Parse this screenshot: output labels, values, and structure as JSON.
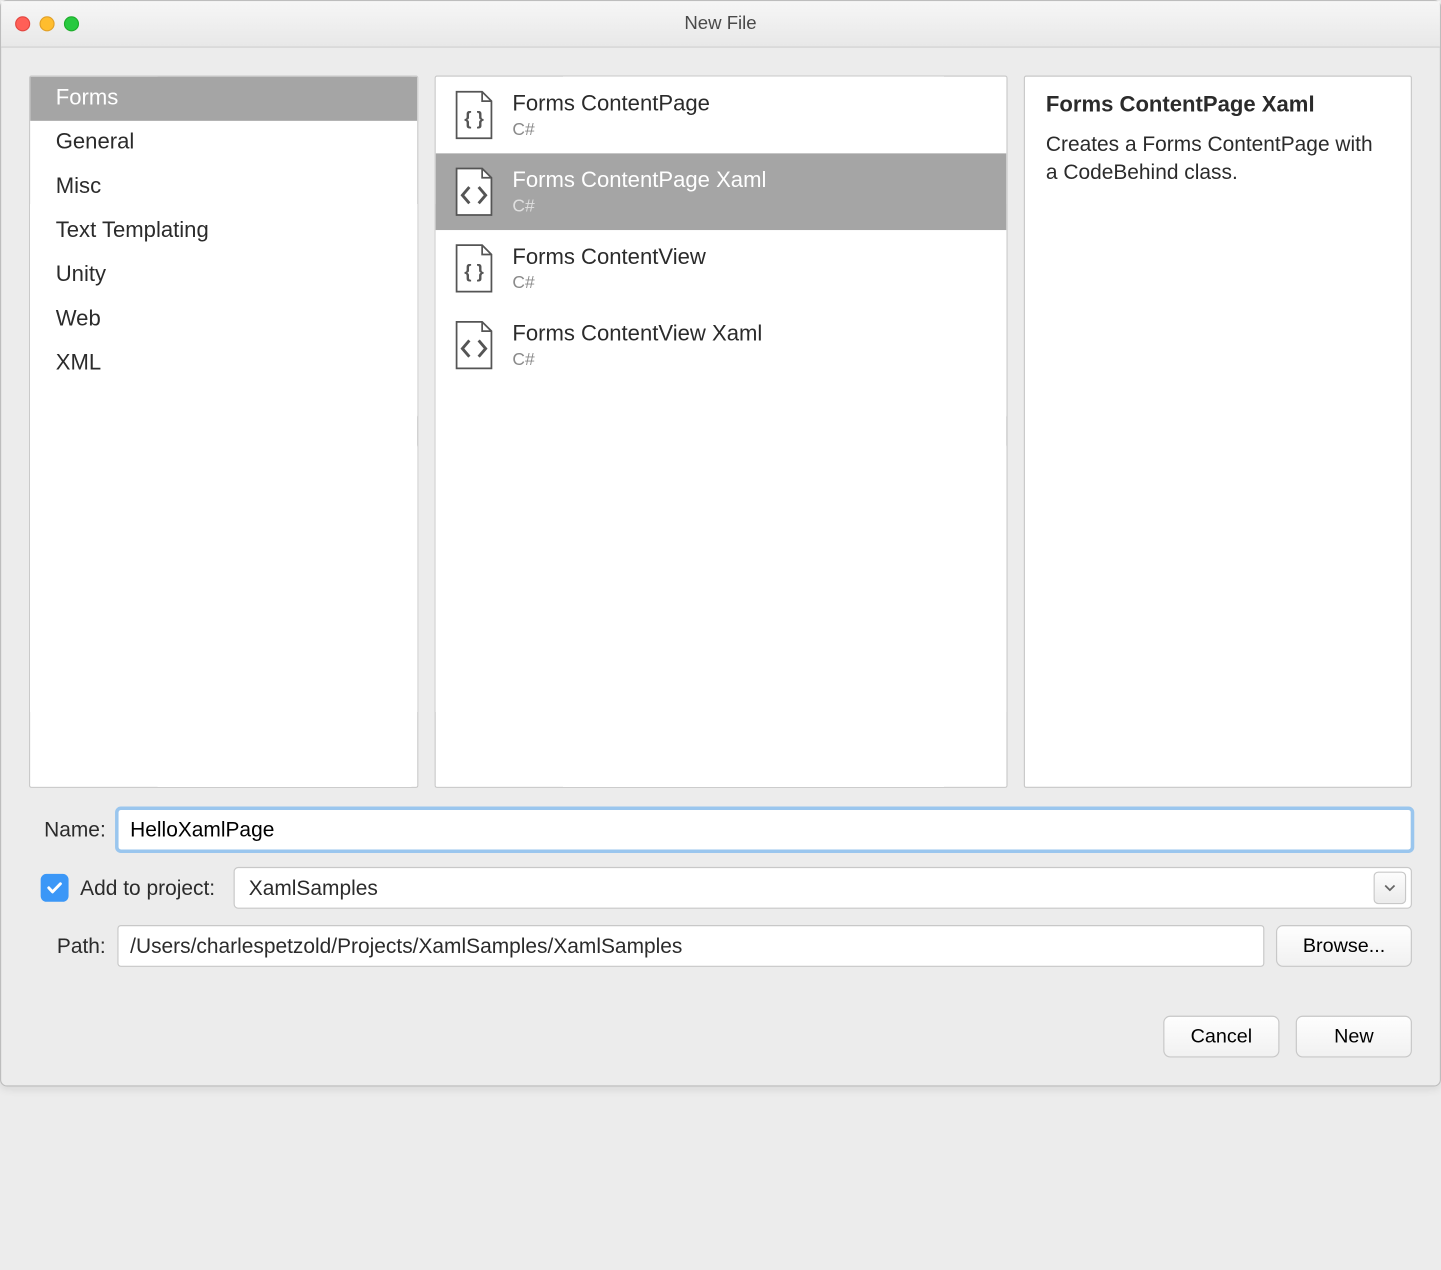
{
  "window": {
    "title": "New File"
  },
  "categories": {
    "items": [
      {
        "label": "Forms",
        "selected": true
      },
      {
        "label": "General",
        "selected": false
      },
      {
        "label": "Misc",
        "selected": false
      },
      {
        "label": "Text Templating",
        "selected": false
      },
      {
        "label": "Unity",
        "selected": false
      },
      {
        "label": "Web",
        "selected": false
      },
      {
        "label": "XML",
        "selected": false
      }
    ]
  },
  "templates": {
    "items": [
      {
        "name": "Forms ContentPage",
        "lang": "C#",
        "icon": "braces",
        "selected": false
      },
      {
        "name": "Forms ContentPage Xaml",
        "lang": "C#",
        "icon": "angles",
        "selected": true
      },
      {
        "name": "Forms ContentView",
        "lang": "C#",
        "icon": "braces",
        "selected": false
      },
      {
        "name": "Forms ContentView Xaml",
        "lang": "C#",
        "icon": "angles",
        "selected": false
      }
    ]
  },
  "description": {
    "title": "Forms ContentPage Xaml",
    "text": "Creates a Forms ContentPage with a CodeBehind class."
  },
  "form": {
    "name_label": "Name:",
    "name_value": "HelloXamlPage",
    "add_to_project_label": "Add to project:",
    "project_value": "XamlSamples",
    "path_label": "Path:",
    "path_value": "/Users/charlespetzold/Projects/XamlSamples/XamlSamples",
    "browse_label": "Browse...",
    "cancel_label": "Cancel",
    "new_label": "New"
  }
}
